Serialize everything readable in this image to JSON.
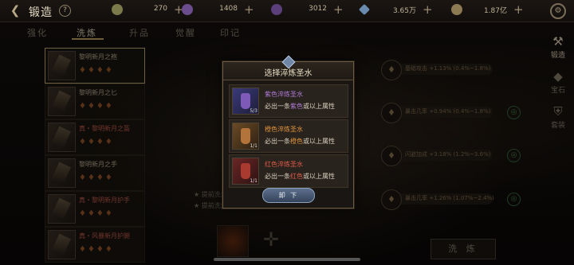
{
  "header": {
    "title": "锻造",
    "help": "?",
    "resources": [
      {
        "name": "resource-1",
        "value": "270",
        "color": "#7a7a4a"
      },
      {
        "name": "resource-2",
        "value": "1408",
        "color": "#6b4c8c"
      },
      {
        "name": "resource-3",
        "value": "3012",
        "color": "#5b3f7a"
      },
      {
        "name": "diamond",
        "value": "3.65万",
        "color": "#6a8bb0"
      },
      {
        "name": "gold",
        "value": "1.87亿",
        "color": "#8c7a52"
      }
    ],
    "plus": "+"
  },
  "tabs": [
    "强化",
    "洗炼",
    "升品",
    "觉醒",
    "印记"
  ],
  "active_tab": 1,
  "equipment": [
    {
      "name": "黎明新月之袍",
      "drops": "♦♦♦♦",
      "color": "normal",
      "selected": true
    },
    {
      "name": "黎明新月之匕",
      "drops": "♦♦♦♦",
      "color": "normal",
      "selected": false
    },
    {
      "name": "真・黎明新月之盔",
      "drops": "♦♦♦♦",
      "color": "red",
      "selected": false
    },
    {
      "name": "黎明新月之手",
      "drops": "♦♦♦♦",
      "color": "normal",
      "selected": false
    },
    {
      "name": "真・黎明新月护手",
      "drops": "♦♦♦♦",
      "color": "red",
      "selected": false
    },
    {
      "name": "真・风暴新月护腿",
      "drops": "♦♦♦♦",
      "color": "red",
      "selected": false
    }
  ],
  "attributes": [
    {
      "text": "基础攻击 +1.13% (0.4%~1.8%)",
      "icon": "drop-icon"
    },
    {
      "text": "暴击几率 +0.94% (0.4%~1.8%)",
      "icon": "drop-icon"
    },
    {
      "text": "闪避加成 +3.18% (1.2%~3.6%)",
      "icon": "drop-icon"
    },
    {
      "text": "暴击几率 +1.26% (1.07%~2.4%)",
      "icon": "drop-icon"
    }
  ],
  "hints": [
    "★ 提前洗炼…",
    "★ 提前洗炼…"
  ],
  "wash_button": "洗 炼",
  "side_nav": [
    {
      "label": "锻造",
      "icon": "hammer-icon",
      "active": true
    },
    {
      "label": "宝石",
      "icon": "gem-icon",
      "active": false
    },
    {
      "label": "套装",
      "icon": "armor-icon",
      "active": false
    }
  ],
  "modal": {
    "title": "选择淬炼圣水",
    "options": [
      {
        "name": "紫色淬炼圣水",
        "desc_prefix": "必出一条",
        "desc_color_word": "紫色",
        "desc_suffix": "或以上属性",
        "color": "#b07ad6",
        "bottle_color": "#7e5ab8",
        "level": "5/3"
      },
      {
        "name": "橙色淬炼圣水",
        "desc_prefix": "必出一条",
        "desc_color_word": "橙色",
        "desc_suffix": "或以上属性",
        "color": "#e0933c",
        "bottle_color": "#b2743a",
        "level": "1/1"
      },
      {
        "name": "红色淬炼圣水",
        "desc_prefix": "必出一条",
        "desc_color_word": "红色",
        "desc_suffix": "或以上属性",
        "color": "#e05a4a",
        "bottle_color": "#a83a2f",
        "level": "1/1"
      }
    ],
    "unload_button": "卸 下"
  }
}
